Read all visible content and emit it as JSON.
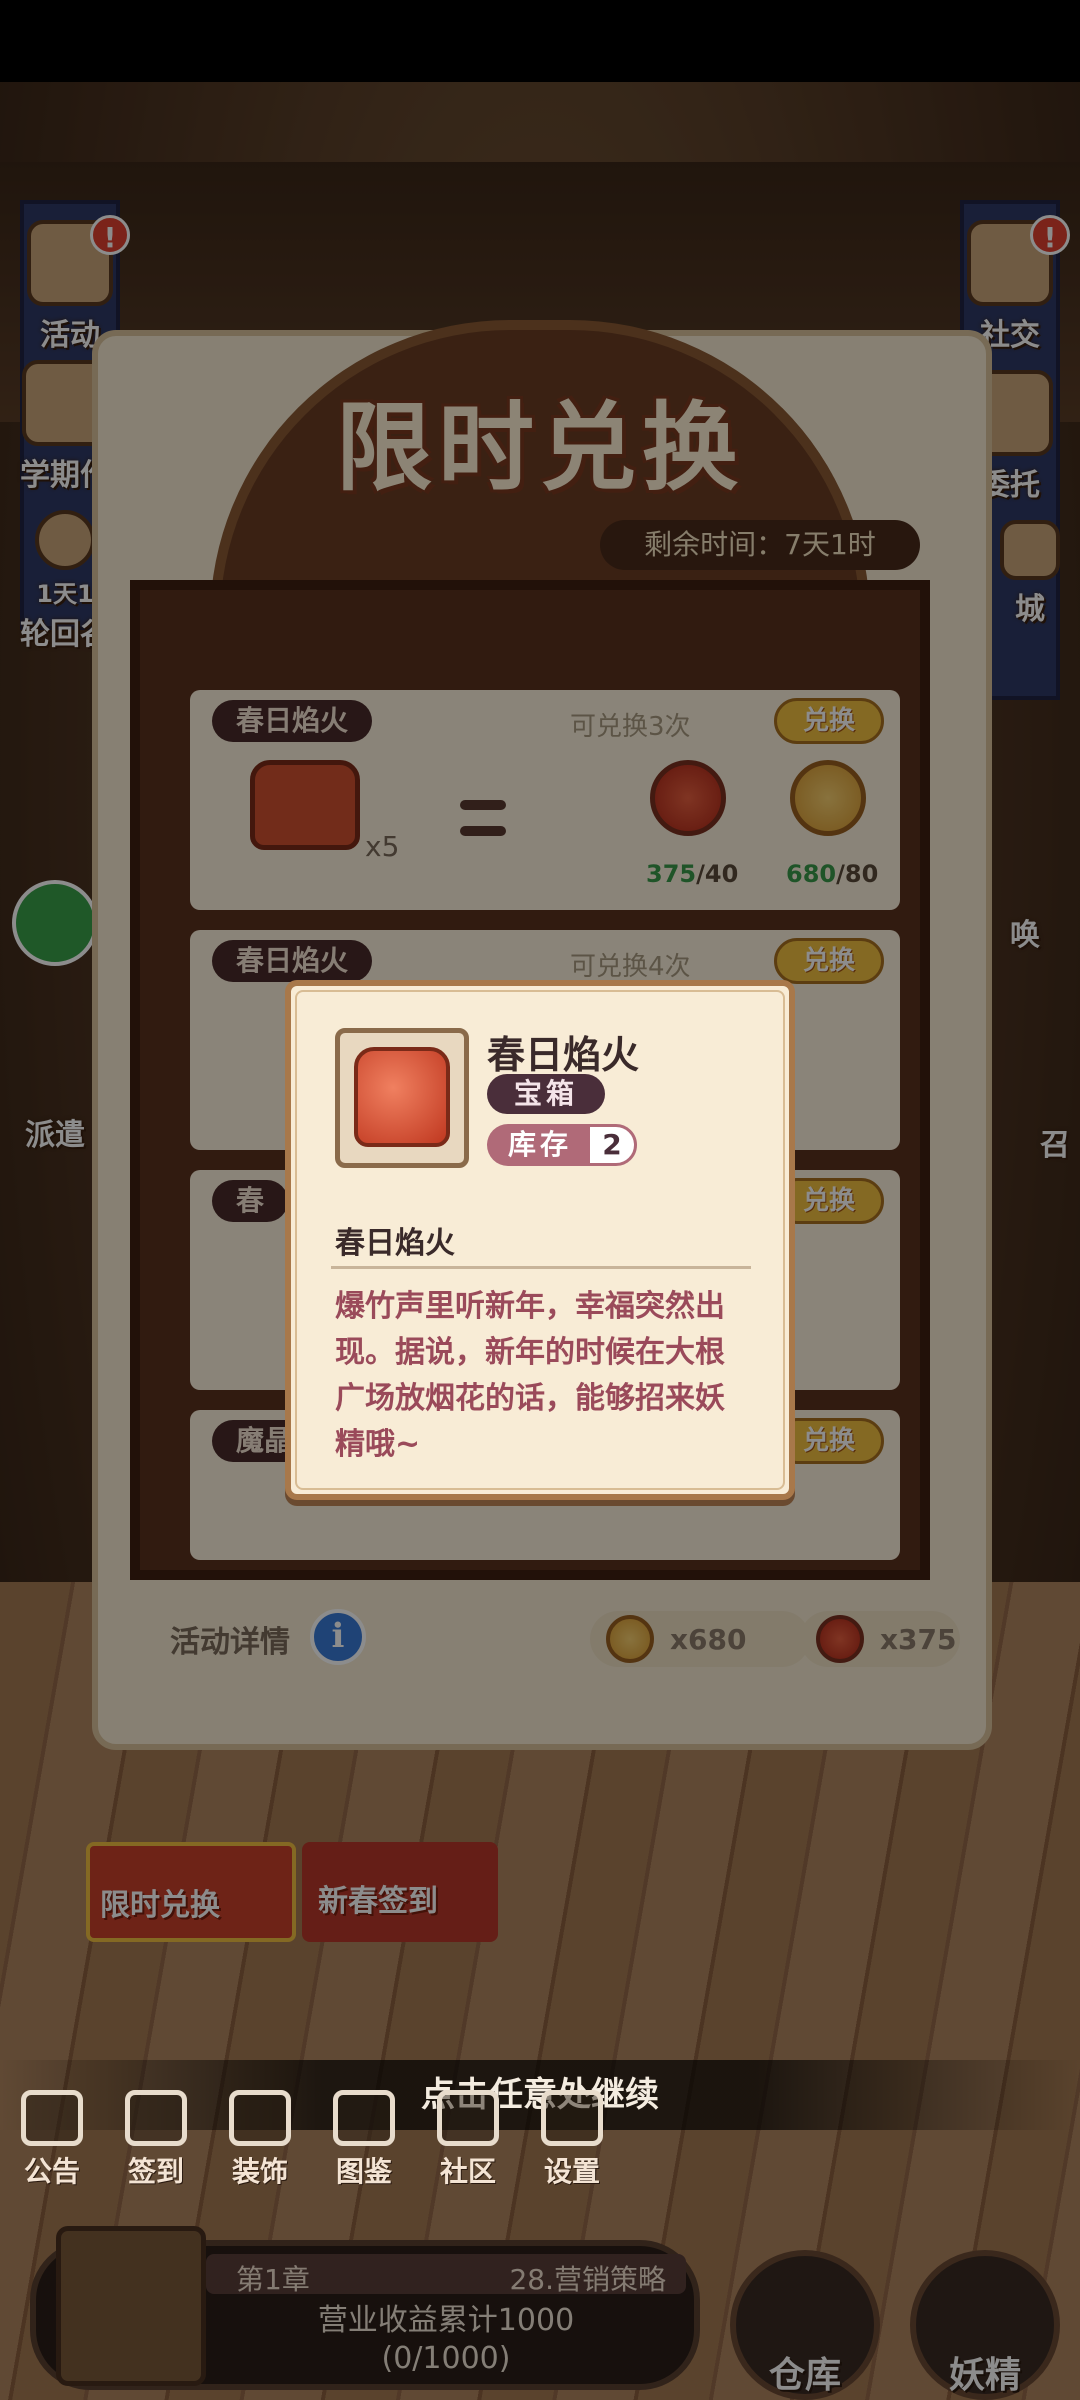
{
  "side_left": [
    {
      "label": "活动",
      "alert": "!"
    },
    {
      "label": "学期作",
      "alert": ""
    },
    {
      "label": "1天1",
      "sublabel": "轮回谷",
      "alert": ""
    },
    {
      "label": "派遣",
      "alert": ""
    }
  ],
  "side_right": [
    {
      "label": "社交",
      "alert": "!"
    },
    {
      "label": "委托",
      "alert": ""
    },
    {
      "label": "城",
      "alert": ""
    },
    {
      "label": "唤",
      "alert": ""
    },
    {
      "label": "召",
      "alert": ""
    }
  ],
  "exchange": {
    "title": "限时兑换",
    "timer": "剩余时间：7天1时",
    "rows": [
      {
        "name": "春日焰火",
        "remaining": "可兑换3次",
        "button": "兑换",
        "qty": "x5",
        "cost": [
          {
            "have": "375",
            "need": "/40",
            "coin": "red"
          },
          {
            "have": "680",
            "need": "/80",
            "coin": "gold"
          }
        ]
      },
      {
        "name": "春日焰火",
        "remaining": "可兑换4次",
        "button": "兑换"
      },
      {
        "name": "春",
        "remaining": "",
        "button": "兑换"
      },
      {
        "name": "魔晶",
        "remaining": "",
        "button": "兑换"
      }
    ],
    "detail_label": "活动详情",
    "info_icon": "i",
    "stock_gold": "x680",
    "stock_red": "x375"
  },
  "events": [
    {
      "label": "限时兑换",
      "color": "#c8402a"
    },
    {
      "label": "新春签到",
      "color": "#c83a2a"
    }
  ],
  "continue_hint": "点击任意处继续",
  "bottom_tabs": [
    {
      "label": "公告",
      "icon": "notice-icon"
    },
    {
      "label": "签到",
      "icon": "calendar-check-icon"
    },
    {
      "label": "装饰",
      "icon": "decor-icon"
    },
    {
      "label": "图鉴",
      "icon": "book-icon"
    },
    {
      "label": "社区",
      "icon": "community-icon"
    },
    {
      "label": "设置",
      "icon": "gear-icon"
    }
  ],
  "chapter": {
    "chapter_label": "第1章",
    "task_label": "28.营销策略",
    "goal": "营业收益累计1000",
    "progress_text": "(0/1000)",
    "progress": 0
  },
  "round_buttons": [
    {
      "label": "仓库"
    },
    {
      "label": "妖精"
    }
  ],
  "dialog": {
    "item_name": "春日焰火",
    "item_type": "宝箱",
    "stock_label": "库存",
    "stock_value": "2",
    "desc_title": "春日焰火",
    "desc": "爆竹声里听新年，幸福突然出现。据说，新年的时候在大根广场放烟花的话，能够招来妖精哦~"
  }
}
